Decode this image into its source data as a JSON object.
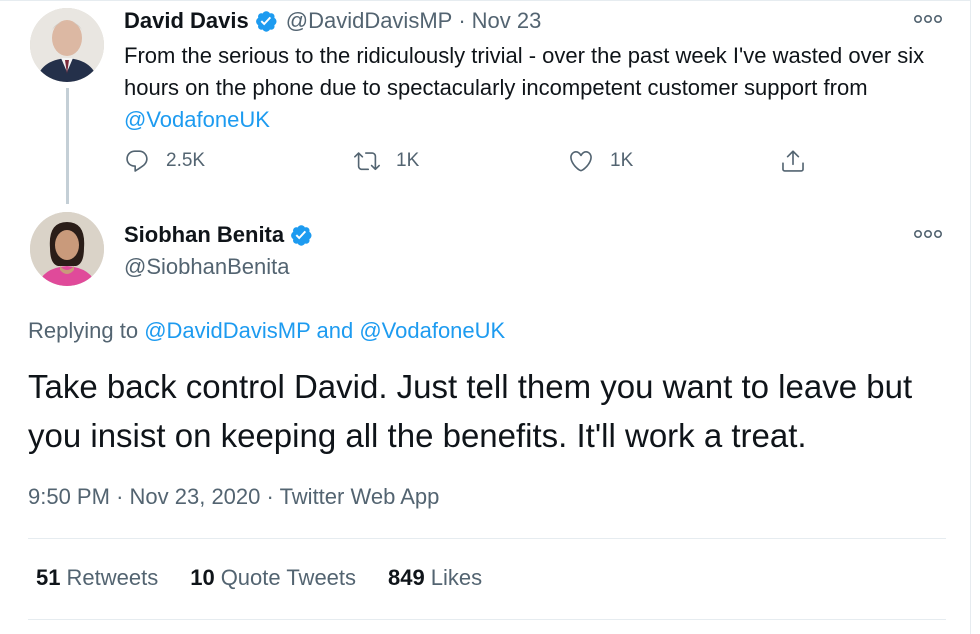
{
  "parent_tweet": {
    "author_name": "David Davis",
    "handle": "@DavidDavisMP",
    "separator": "·",
    "date": "Nov 23",
    "text_prefix": "From the serious to the ridiculously trivial - over the past week I've wasted over six hours on the phone due to spectacularly incompetent customer support from ",
    "text_mention": "@VodafoneUK",
    "replies": "2.5K",
    "retweets": "1K",
    "likes": "1K",
    "icons": [
      "reply-icon",
      "retweet-icon",
      "like-icon",
      "share-icon",
      "more-icon",
      "verified-icon"
    ]
  },
  "main_tweet": {
    "author_name": "Siobhan Benita",
    "handle": "@SiobhanBenita",
    "replying_prefix": "Replying to ",
    "replying_to_1": "@DavidDavisMP",
    "replying_and": " and ",
    "replying_to_2": "@VodafoneUK",
    "text": "Take back control David.  Just tell them you want to leave but you insist on keeping all the benefits.  It'll work a treat.",
    "time": "9:50 PM",
    "separator": "·",
    "full_date": "Nov 23, 2020",
    "source": "Twitter Web App",
    "retweets_count": "51",
    "retweets_label": "Retweets",
    "quote_count": "10",
    "quote_label": "Quote Tweets",
    "likes_count": "849",
    "likes_label": "Likes"
  },
  "colors": {
    "link": "#1d9bf0",
    "muted": "#536471",
    "text": "#0f1419",
    "verified": "#1d9bf0"
  }
}
